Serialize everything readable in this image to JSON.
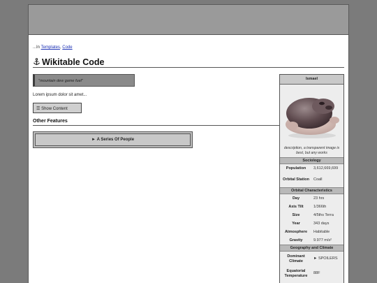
{
  "breadcrumb": {
    "prefix": "...In ",
    "link1": "Templates",
    "sep": ", ",
    "link2": "Code"
  },
  "page": {
    "title": "Wikitable Code"
  },
  "quote": {
    "text": "\"mountain dew game fuel\""
  },
  "lorem": "Lorem ipsum dolor sit amet...",
  "show_content": {
    "icon": "☰",
    "label": "Show Content"
  },
  "other_features": {
    "heading": "Other Features",
    "item_icon": "►",
    "item_label": "A Series Of People"
  },
  "infobox": {
    "title": "Ismael",
    "caption": "description, a transparent image is best, but any works",
    "sections": [
      {
        "heading": "Sociology",
        "rows": [
          {
            "label": "Population",
            "value": "3,612,669,699"
          },
          {
            "label": "Orbital Station",
            "value": "Coall"
          }
        ]
      },
      {
        "heading": "Orbital Characteristics",
        "rows": [
          {
            "label": "Day",
            "value": "23 hrs"
          },
          {
            "label": "Axis Tilt",
            "value": "1/366th"
          },
          {
            "label": "Size",
            "value": "4/5ths Terra"
          },
          {
            "label": "Year",
            "value": "343 days"
          },
          {
            "label": "Atmosphere",
            "value": "Habitable"
          },
          {
            "label": "Gravity",
            "value": "9.977 m/s²"
          }
        ]
      },
      {
        "heading": "Geography and Climate",
        "rows": [
          {
            "label": "Dominant Climate",
            "value": "► SPOILERS"
          },
          {
            "label": "Equatorial Temperature",
            "value": "88F"
          }
        ]
      }
    ]
  },
  "colors": {
    "link": "#1a2fb4",
    "banner": "#9a9a9a",
    "background": "#7b7b7b"
  },
  "icons": {
    "title_icon": "anchor-icon",
    "infobox_image": "planet-creature-image"
  }
}
